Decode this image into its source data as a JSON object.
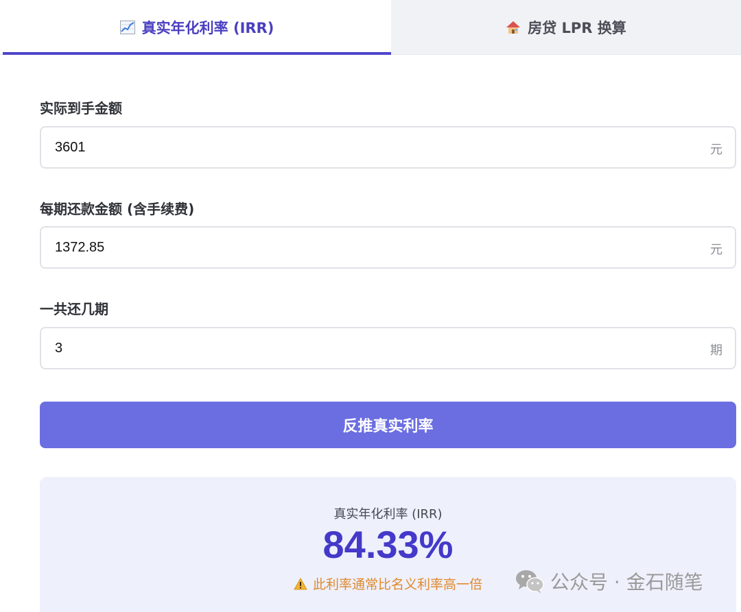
{
  "tabs": [
    {
      "label": "真实年化利率 (IRR)",
      "icon": "chart-increasing-icon",
      "active": true
    },
    {
      "label": "房贷 LPR 换算",
      "icon": "house-icon",
      "active": false
    }
  ],
  "form": {
    "net_amount": {
      "label": "实际到手金额",
      "value": "3601",
      "unit": "元"
    },
    "payment": {
      "label": "每期还款金额 (含手续费)",
      "value": "1372.85",
      "unit": "元"
    },
    "periods": {
      "label": "一共还几期",
      "value": "3",
      "unit": "期"
    }
  },
  "submit_label": "反推真实利率",
  "result": {
    "label": "真实年化利率 (IRR)",
    "value": "84.33%",
    "note": "此利率通常比名义利率高一倍"
  },
  "watermark": {
    "text": "公众号 · 金石随笔"
  },
  "colors": {
    "accent": "#4f45c9",
    "button": "#6b6ee0",
    "result_value": "#4539c9",
    "warning": "#e0892a",
    "result_bg": "#eef0fc"
  }
}
